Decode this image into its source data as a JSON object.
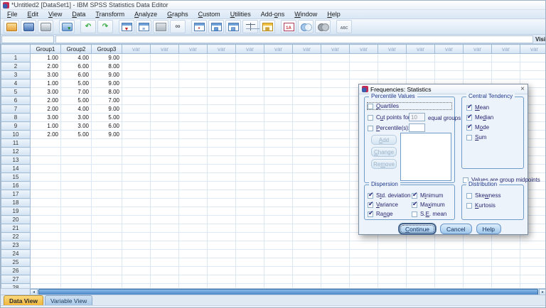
{
  "window": {
    "title": "*Untitled2 [DataSet1] - IBM SPSS Statistics Data Editor"
  },
  "menu": {
    "items": [
      {
        "label": "File",
        "u": 0
      },
      {
        "label": "Edit",
        "u": 0
      },
      {
        "label": "View",
        "u": 0
      },
      {
        "label": "Data",
        "u": 0
      },
      {
        "label": "Transform",
        "u": 0
      },
      {
        "label": "Analyze",
        "u": 0
      },
      {
        "label": "Graphs",
        "u": 0
      },
      {
        "label": "Custom",
        "u": 0
      },
      {
        "label": "Utilities",
        "u": 0
      },
      {
        "label": "Add-ons",
        "u": 4
      },
      {
        "label": "Window",
        "u": 0
      },
      {
        "label": "Help",
        "u": 0
      }
    ]
  },
  "toolbar": {
    "icons": [
      {
        "name": "open-data-icon",
        "base": "folder"
      },
      {
        "name": "save-icon",
        "base": "disk"
      },
      {
        "name": "print-icon",
        "base": "printer"
      },
      {
        "name": "dialog-recall-icon",
        "base": "recall",
        "glyph": "▾",
        "color": "#1f8a1f"
      },
      {
        "name": "undo-icon",
        "base": "plain",
        "glyph": "↶",
        "color": "#3fae49"
      },
      {
        "name": "redo-icon",
        "base": "plain",
        "glyph": "↷",
        "color": "#3fae49"
      },
      {
        "name": "goto-case-icon",
        "base": "table",
        "glyph": "▼",
        "color": "#c22a2a"
      },
      {
        "name": "variables-icon",
        "base": "table",
        "glyph": "≡",
        "color": "#2f6fbe"
      },
      {
        "name": "goto-variable-icon",
        "base": "clip",
        "glyph": "",
        "color": ""
      },
      {
        "name": "find-icon",
        "base": "plain",
        "glyph": "∞",
        "color": "#555b63"
      },
      {
        "name": "insert-cases-icon",
        "base": "table",
        "glyph": "*",
        "color": "#c22a2a"
      },
      {
        "name": "insert-variable-icon",
        "base": "table",
        "glyph": "▨",
        "color": "#2f6fbe"
      },
      {
        "name": "split-file-icon",
        "base": "table",
        "glyph": "▤",
        "color": "#2f6fbe"
      },
      {
        "name": "weight-cases-icon",
        "base": "scales",
        "glyph": "",
        "color": ""
      },
      {
        "name": "select-cases-icon",
        "base": "tabley",
        "glyph": "▦",
        "color": "#c79a26"
      },
      {
        "name": "value-labels-icon",
        "base": "labels",
        "glyph": "1A",
        "color": "#c22a2a"
      },
      {
        "name": "use-variable-sets-icon",
        "base": "circles",
        "glyph": "",
        "color": ""
      },
      {
        "name": "show-all-variables-icon",
        "base": "circgray",
        "glyph": "",
        "color": ""
      },
      {
        "name": "spell-check-icon",
        "base": "abc",
        "glyph": "ABC",
        "color": "#6d757d"
      }
    ]
  },
  "cellref": {
    "value": "",
    "visible_label": "Visi"
  },
  "grid": {
    "columns": [
      "Group1",
      "Group2",
      "Group3"
    ],
    "var_label": "var",
    "var_count": 15,
    "row_count": 28,
    "rows": [
      {
        "n": "1",
        "values": [
          "1.00",
          "4.00",
          "9.00"
        ]
      },
      {
        "n": "2",
        "values": [
          "2.00",
          "6.00",
          "8.00"
        ]
      },
      {
        "n": "3",
        "values": [
          "3.00",
          "6.00",
          "9.00"
        ]
      },
      {
        "n": "4",
        "values": [
          "1.00",
          "5.00",
          "9.00"
        ]
      },
      {
        "n": "5",
        "values": [
          "3.00",
          "7.00",
          "8.00"
        ]
      },
      {
        "n": "6",
        "values": [
          "2.00",
          "5.00",
          "7.00"
        ]
      },
      {
        "n": "7",
        "values": [
          "2.00",
          "4.00",
          "9.00"
        ]
      },
      {
        "n": "8",
        "values": [
          "3.00",
          "3.00",
          "5.00"
        ]
      },
      {
        "n": "9",
        "values": [
          "1.00",
          "3.00",
          "6.00"
        ]
      },
      {
        "n": "10",
        "values": [
          "2.00",
          "5.00",
          "9.00"
        ]
      }
    ]
  },
  "tabs": {
    "data_view": "Data View",
    "variable_view": "Variable View"
  },
  "dialog": {
    "title": "Frequencies: Statistics",
    "close_glyph": "×",
    "percentile_values": {
      "title": "Percentile Values",
      "quartiles": {
        "label": "Quartiles",
        "u": 0,
        "checked": false
      },
      "cut_points": {
        "label": "Cut points for:",
        "u": 1,
        "checked": false
      },
      "cut_points_value": "10",
      "equal_groups_label": "equal groups",
      "percentiles": {
        "label": "Percentile(s):",
        "u": 0,
        "checked": false
      },
      "percentiles_value": "",
      "add_button": {
        "label": "Add",
        "u": 0,
        "disabled": true
      },
      "change_button": {
        "label": "Change",
        "u": 0,
        "disabled": true
      },
      "remove_button": {
        "label": "Remove",
        "u": 2,
        "disabled": true
      }
    },
    "central_tendency": {
      "title": "Central Tendency",
      "items": [
        {
          "label": "Mean",
          "u": 0,
          "checked": true
        },
        {
          "label": "Median",
          "u": 2,
          "checked": true
        },
        {
          "label": "Mode",
          "u": 1,
          "checked": true
        },
        {
          "label": "Sum",
          "u": 0,
          "checked": false
        }
      ]
    },
    "midpoints": {
      "label": "Values are group midpoints",
      "u": 3,
      "checked": false
    },
    "dispersion": {
      "title": "Dispersion",
      "col1": [
        {
          "label": "Std. deviation",
          "u": 1,
          "checked": true
        },
        {
          "label": "Variance",
          "u": 0,
          "checked": true
        },
        {
          "label": "Range",
          "u": 2,
          "checked": true
        }
      ],
      "col2": [
        {
          "label": "Minimum",
          "u": 1,
          "checked": true
        },
        {
          "label": "Maximum",
          "u": 2,
          "checked": true
        },
        {
          "label": "S.E. mean",
          "u": 2,
          "checked": false
        }
      ]
    },
    "distribution": {
      "title": "Distribution",
      "items": [
        {
          "label": "Skewness",
          "u": 3,
          "checked": false
        },
        {
          "label": "Kurtosis",
          "u": 0,
          "checked": false
        }
      ]
    },
    "buttons": [
      {
        "label": "Continue",
        "u": 0,
        "default": true
      },
      {
        "label": "Cancel",
        "u": -1,
        "default": false
      },
      {
        "label": "Help",
        "u": -1,
        "default": false
      }
    ]
  },
  "colors": {
    "accent_blue": "#4d86c8",
    "active_tab_gold": "#f0b63c",
    "navy_text": "#26266e",
    "group_title": "#1f3a8c"
  }
}
